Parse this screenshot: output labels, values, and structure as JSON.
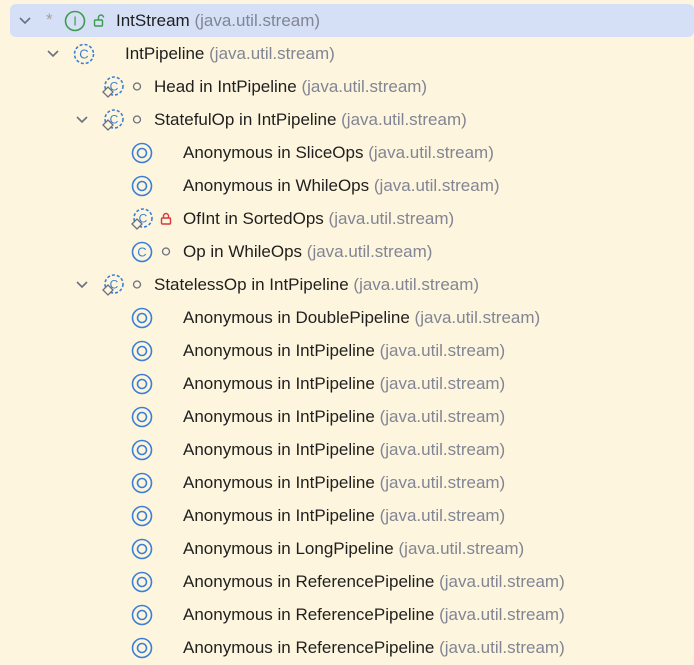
{
  "tree": {
    "rows": [
      {
        "name": "IntStream",
        "pkg": "(java.util.stream)"
      },
      {
        "name": "IntPipeline",
        "pkg": "(java.util.stream)"
      },
      {
        "name": "Head in IntPipeline",
        "pkg": "(java.util.stream)"
      },
      {
        "name": "StatefulOp in IntPipeline",
        "pkg": "(java.util.stream)"
      },
      {
        "name": "Anonymous in SliceOps",
        "pkg": "(java.util.stream)"
      },
      {
        "name": "Anonymous in WhileOps",
        "pkg": "(java.util.stream)"
      },
      {
        "name": "OfInt in SortedOps",
        "pkg": "(java.util.stream)"
      },
      {
        "name": "Op in WhileOps",
        "pkg": "(java.util.stream)"
      },
      {
        "name": "StatelessOp in IntPipeline",
        "pkg": "(java.util.stream)"
      },
      {
        "name": "Anonymous in DoublePipeline",
        "pkg": "(java.util.stream)"
      },
      {
        "name": "Anonymous in IntPipeline",
        "pkg": "(java.util.stream)"
      },
      {
        "name": "Anonymous in IntPipeline",
        "pkg": "(java.util.stream)"
      },
      {
        "name": "Anonymous in IntPipeline",
        "pkg": "(java.util.stream)"
      },
      {
        "name": "Anonymous in IntPipeline",
        "pkg": "(java.util.stream)"
      },
      {
        "name": "Anonymous in IntPipeline",
        "pkg": "(java.util.stream)"
      },
      {
        "name": "Anonymous in IntPipeline",
        "pkg": "(java.util.stream)"
      },
      {
        "name": "Anonymous in LongPipeline",
        "pkg": "(java.util.stream)"
      },
      {
        "name": "Anonymous in ReferencePipeline",
        "pkg": "(java.util.stream)"
      },
      {
        "name": "Anonymous in ReferencePipeline",
        "pkg": "(java.util.stream)"
      },
      {
        "name": "Anonymous in ReferencePipeline",
        "pkg": "(java.util.stream)"
      }
    ]
  },
  "icons": {
    "row0": [
      "chevron-down-icon",
      "star-icon",
      "interface-icon",
      "unlocked-icon"
    ],
    "row1": [
      "chevron-down-icon",
      "abstract-class-icon"
    ],
    "row2": [
      "abstract-class-icon",
      "package-private-icon"
    ],
    "row3": [
      "chevron-down-icon",
      "abstract-class-icon",
      "package-private-icon"
    ],
    "anonymous": "anonymous-class-icon",
    "row6": [
      "abstract-class-icon",
      "private-lock-icon"
    ],
    "row7": [
      "class-icon",
      "package-private-icon"
    ]
  },
  "colors": {
    "background": "#fdf5dd",
    "selection": "#d5e0f7",
    "interface": "#3d9a50",
    "class": "#3a7fd6",
    "lock_red": "#d9383c",
    "package_text": "#818594"
  }
}
